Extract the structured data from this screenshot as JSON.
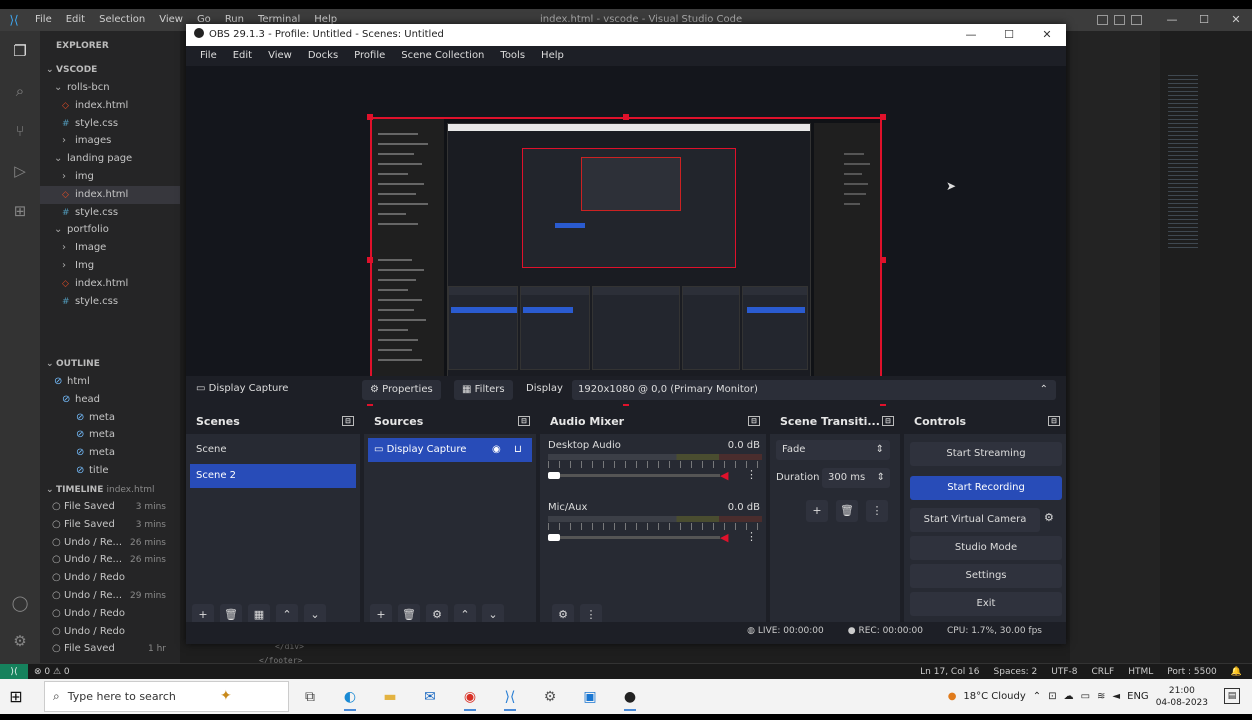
{
  "vscode": {
    "menu": [
      "File",
      "Edit",
      "Selection",
      "View",
      "Go",
      "Run",
      "Terminal",
      "Help"
    ],
    "window_title": "index.html - vscode - Visual Studio Code",
    "explorer_header": "EXPLORER",
    "folder": "VSCODE",
    "tree": [
      {
        "label": "rolls-bcn",
        "depth": 1,
        "type": "folder"
      },
      {
        "label": "index.html",
        "depth": 2,
        "type": "html"
      },
      {
        "label": "style.css",
        "depth": 2,
        "type": "css"
      },
      {
        "label": "images",
        "depth": 2,
        "type": "folder"
      },
      {
        "label": "landing page",
        "depth": 1,
        "type": "folder"
      },
      {
        "label": "img",
        "depth": 2,
        "type": "folder"
      },
      {
        "label": "index.html",
        "depth": 2,
        "type": "html",
        "selected": true
      },
      {
        "label": "style.css",
        "depth": 2,
        "type": "css"
      },
      {
        "label": "portfolio",
        "depth": 1,
        "type": "folder"
      },
      {
        "label": "Image",
        "depth": 2,
        "type": "folder"
      },
      {
        "label": "Img",
        "depth": 2,
        "type": "folder"
      },
      {
        "label": "index.html",
        "depth": 2,
        "type": "html"
      },
      {
        "label": "style.css",
        "depth": 2,
        "type": "css"
      }
    ],
    "outline_header": "OUTLINE",
    "outline": [
      "html",
      "head",
      "meta",
      "meta",
      "meta",
      "title"
    ],
    "timeline_header": "TIMELINE",
    "timeline_file": "index.html",
    "timeline": [
      {
        "label": "File Saved",
        "time": "3 mins"
      },
      {
        "label": "File Saved",
        "time": "3 mins"
      },
      {
        "label": "Undo / Re...",
        "time": "26 mins"
      },
      {
        "label": "Undo / Re...",
        "time": "26 mins"
      },
      {
        "label": "Undo / Redo",
        "time": ""
      },
      {
        "label": "Undo / Re...",
        "time": "29 mins"
      },
      {
        "label": "Undo / Redo",
        "time": ""
      },
      {
        "label": "Undo / Redo",
        "time": ""
      },
      {
        "label": "File Saved",
        "time": "1 hr"
      }
    ],
    "code_bottom": [
      "</div>",
      "</footer>"
    ],
    "status_left": "⊗ 0 ⚠ 0",
    "status_right": [
      "Ln 17, Col 16",
      "Spaces: 2",
      "UTF-8",
      "CRLF",
      "HTML",
      "Port : 5500"
    ]
  },
  "obs": {
    "title": "OBS 29.1.3 - Profile: Untitled - Scenes: Untitled",
    "menu": [
      "File",
      "Edit",
      "View",
      "Docks",
      "Profile",
      "Scene Collection",
      "Tools",
      "Help"
    ],
    "source_bar": {
      "name": "Display Capture",
      "properties": "Properties",
      "filters": "Filters",
      "display_label": "Display",
      "display_value": "1920x1080 @ 0,0 (Primary Monitor)"
    },
    "scenes": {
      "title": "Scenes",
      "items": [
        "Scene",
        "Scene 2"
      ],
      "selected": 1
    },
    "sources": {
      "title": "Sources",
      "items": [
        "Display Capture"
      ]
    },
    "mixer": {
      "title": "Audio Mixer",
      "channels": [
        {
          "name": "Desktop Audio",
          "db": "0.0 dB"
        },
        {
          "name": "Mic/Aux",
          "db": "0.0 dB"
        }
      ]
    },
    "transitions": {
      "title": "Scene Transiti...",
      "type": "Fade",
      "duration_label": "Duration",
      "duration": "300 ms"
    },
    "controls": {
      "title": "Controls",
      "buttons": [
        "Start Streaming",
        "Start Recording",
        "Start Virtual Camera",
        "Studio Mode",
        "Settings",
        "Exit"
      ]
    },
    "status": [
      "LIVE: 00:00:00",
      "REC: 00:00:00",
      "CPU: 1.7%, 30.00 fps"
    ]
  },
  "taskbar": {
    "search_placeholder": "Type here to search",
    "weather": "18°C Cloudy",
    "clock_time": "21:00",
    "clock_date": "04-08-2023"
  },
  "colors": {
    "accent": "#284cb8",
    "selection_border": "#e0112b"
  }
}
